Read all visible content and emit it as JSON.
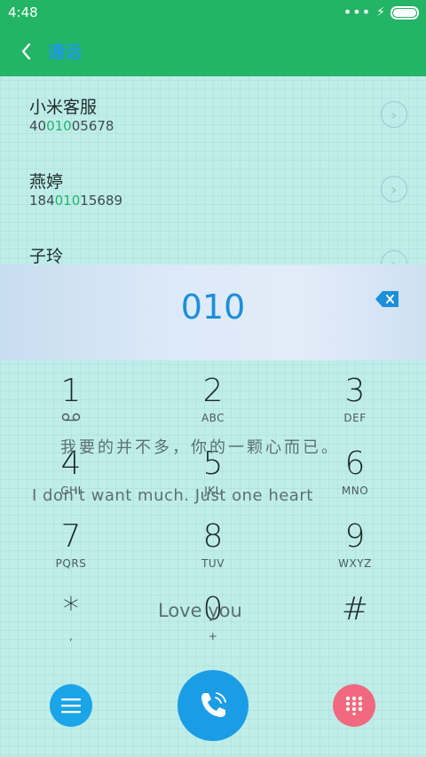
{
  "status_bar": {
    "time": "4:48"
  },
  "app_bar": {
    "title": "通话"
  },
  "contacts": [
    {
      "name": "小米客服",
      "number_pre": "40",
      "number_match": "010",
      "number_post": "05678"
    },
    {
      "name": "燕婷",
      "number_pre": "184",
      "number_match": "010",
      "number_post": "15689"
    },
    {
      "name": "子玲",
      "number_pre": "",
      "number_match": "",
      "number_post": ""
    }
  ],
  "dial_display": {
    "digits": "010"
  },
  "keypad": [
    {
      "main": "1",
      "sub": ""
    },
    {
      "main": "2",
      "sub": "ABC"
    },
    {
      "main": "3",
      "sub": "DEF"
    },
    {
      "main": "4",
      "sub": "GHI"
    },
    {
      "main": "5",
      "sub": "JKL"
    },
    {
      "main": "6",
      "sub": "MNO"
    },
    {
      "main": "7",
      "sub": "PQRS"
    },
    {
      "main": "8",
      "sub": "TUV"
    },
    {
      "main": "9",
      "sub": "WXYZ"
    },
    {
      "main": "*",
      "sub": ","
    },
    {
      "main": "0",
      "sub": "+"
    },
    {
      "main": "#",
      "sub": ""
    }
  ],
  "theme_text": {
    "line1": "我要的并不多，你的一颗心而已。",
    "line2": "I don't want much. Just one heart",
    "line3": "Love you"
  },
  "icons": {
    "back": "chevron-left-icon",
    "row_detail": "chevron-right-icon",
    "delete": "backspace-icon",
    "voicemail": "voicemail-icon",
    "menu": "menu-icon",
    "call": "phone-icon",
    "dialpad": "dialpad-icon"
  },
  "colors": {
    "status_bar": "#23b465",
    "accent": "#1c8fda",
    "match": "#22b36a",
    "call_button": "#1b9de5",
    "menu_button": "#19a5e8",
    "dialpad_button": "#f0697e"
  }
}
